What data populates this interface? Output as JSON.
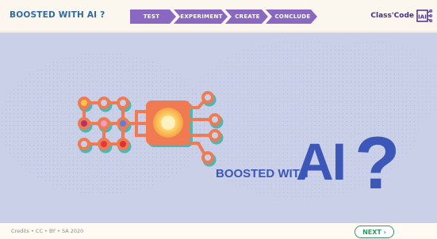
{
  "header": {
    "app_title": "BOOSTED WITH AI ?",
    "steps": [
      {
        "label": "TEST",
        "color": "#8a68c2"
      },
      {
        "label": "EXPERIMENT",
        "color": "#8a68c2"
      },
      {
        "label": "CREATE",
        "color": "#8a68c2"
      },
      {
        "label": "CONCLUDE",
        "color": "#8a68c2"
      }
    ],
    "brand": {
      "name": "Class'Code",
      "logo_text": "IAI"
    }
  },
  "main": {
    "boosted_text": "BOOSTED WITH",
    "ai_text": "AI",
    "question_mark": "?"
  },
  "footer": {
    "credits": "Credits • CC • BY • SA 2020",
    "next_label": "NEXT ›"
  },
  "colors": {
    "accent_purple": "#8a68c2",
    "title_blue": "#2f6aa4",
    "art_blue": "#3c57b8",
    "chip_orange": "#f07a52",
    "next_green": "#2e9a63",
    "background": "#c9d0e8"
  }
}
